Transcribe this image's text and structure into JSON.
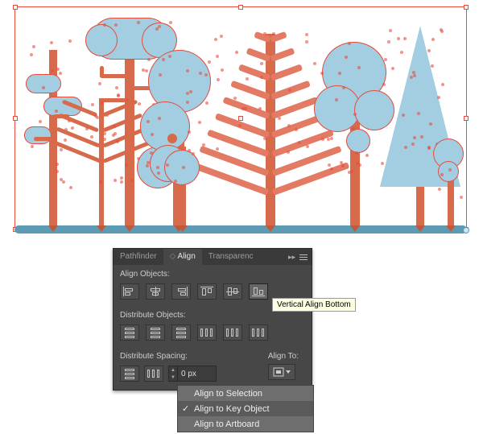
{
  "panel": {
    "tabs": {
      "pathfinder": "Pathfinder",
      "align": "Align",
      "transparency": "Transparenc"
    },
    "section_align": "Align Objects:",
    "section_distribute": "Distribute Objects:",
    "section_spacing": "Distribute Spacing:",
    "align_to_label": "Align To:",
    "spacing_value": "0 px",
    "tooltip": "Vertical Align Bottom",
    "btn": {
      "hal": "horizontal-align-left",
      "hac": "horizontal-align-center",
      "har": "horizontal-align-right",
      "vat": "vertical-align-top",
      "vac": "vertical-align-center",
      "vab": "vertical-align-bottom",
      "vdt": "vertical-distribute-top",
      "vdc": "vertical-distribute-center",
      "vdb": "vertical-distribute-bottom",
      "hdl": "horizontal-distribute-left",
      "hdc": "horizontal-distribute-center",
      "hdr": "horizontal-distribute-right",
      "vds": "vertical-distribute-space",
      "hds": "horizontal-distribute-space"
    }
  },
  "flyout": {
    "items": [
      "Align to Selection",
      "Align to Key Object",
      "Align to Artboard"
    ],
    "selected": 1
  },
  "artwork": {
    "description": "Vector forest illustration: multiple stylized trees (pine, round, cloud) in light blue with orange trunks on a blue ground line, all selected with red anchor points",
    "ground_color": "#5c9bb3",
    "foliage_color": "#a3cde0",
    "trunk_color": "#d66a4a",
    "selection_color": "#e74c3c"
  }
}
